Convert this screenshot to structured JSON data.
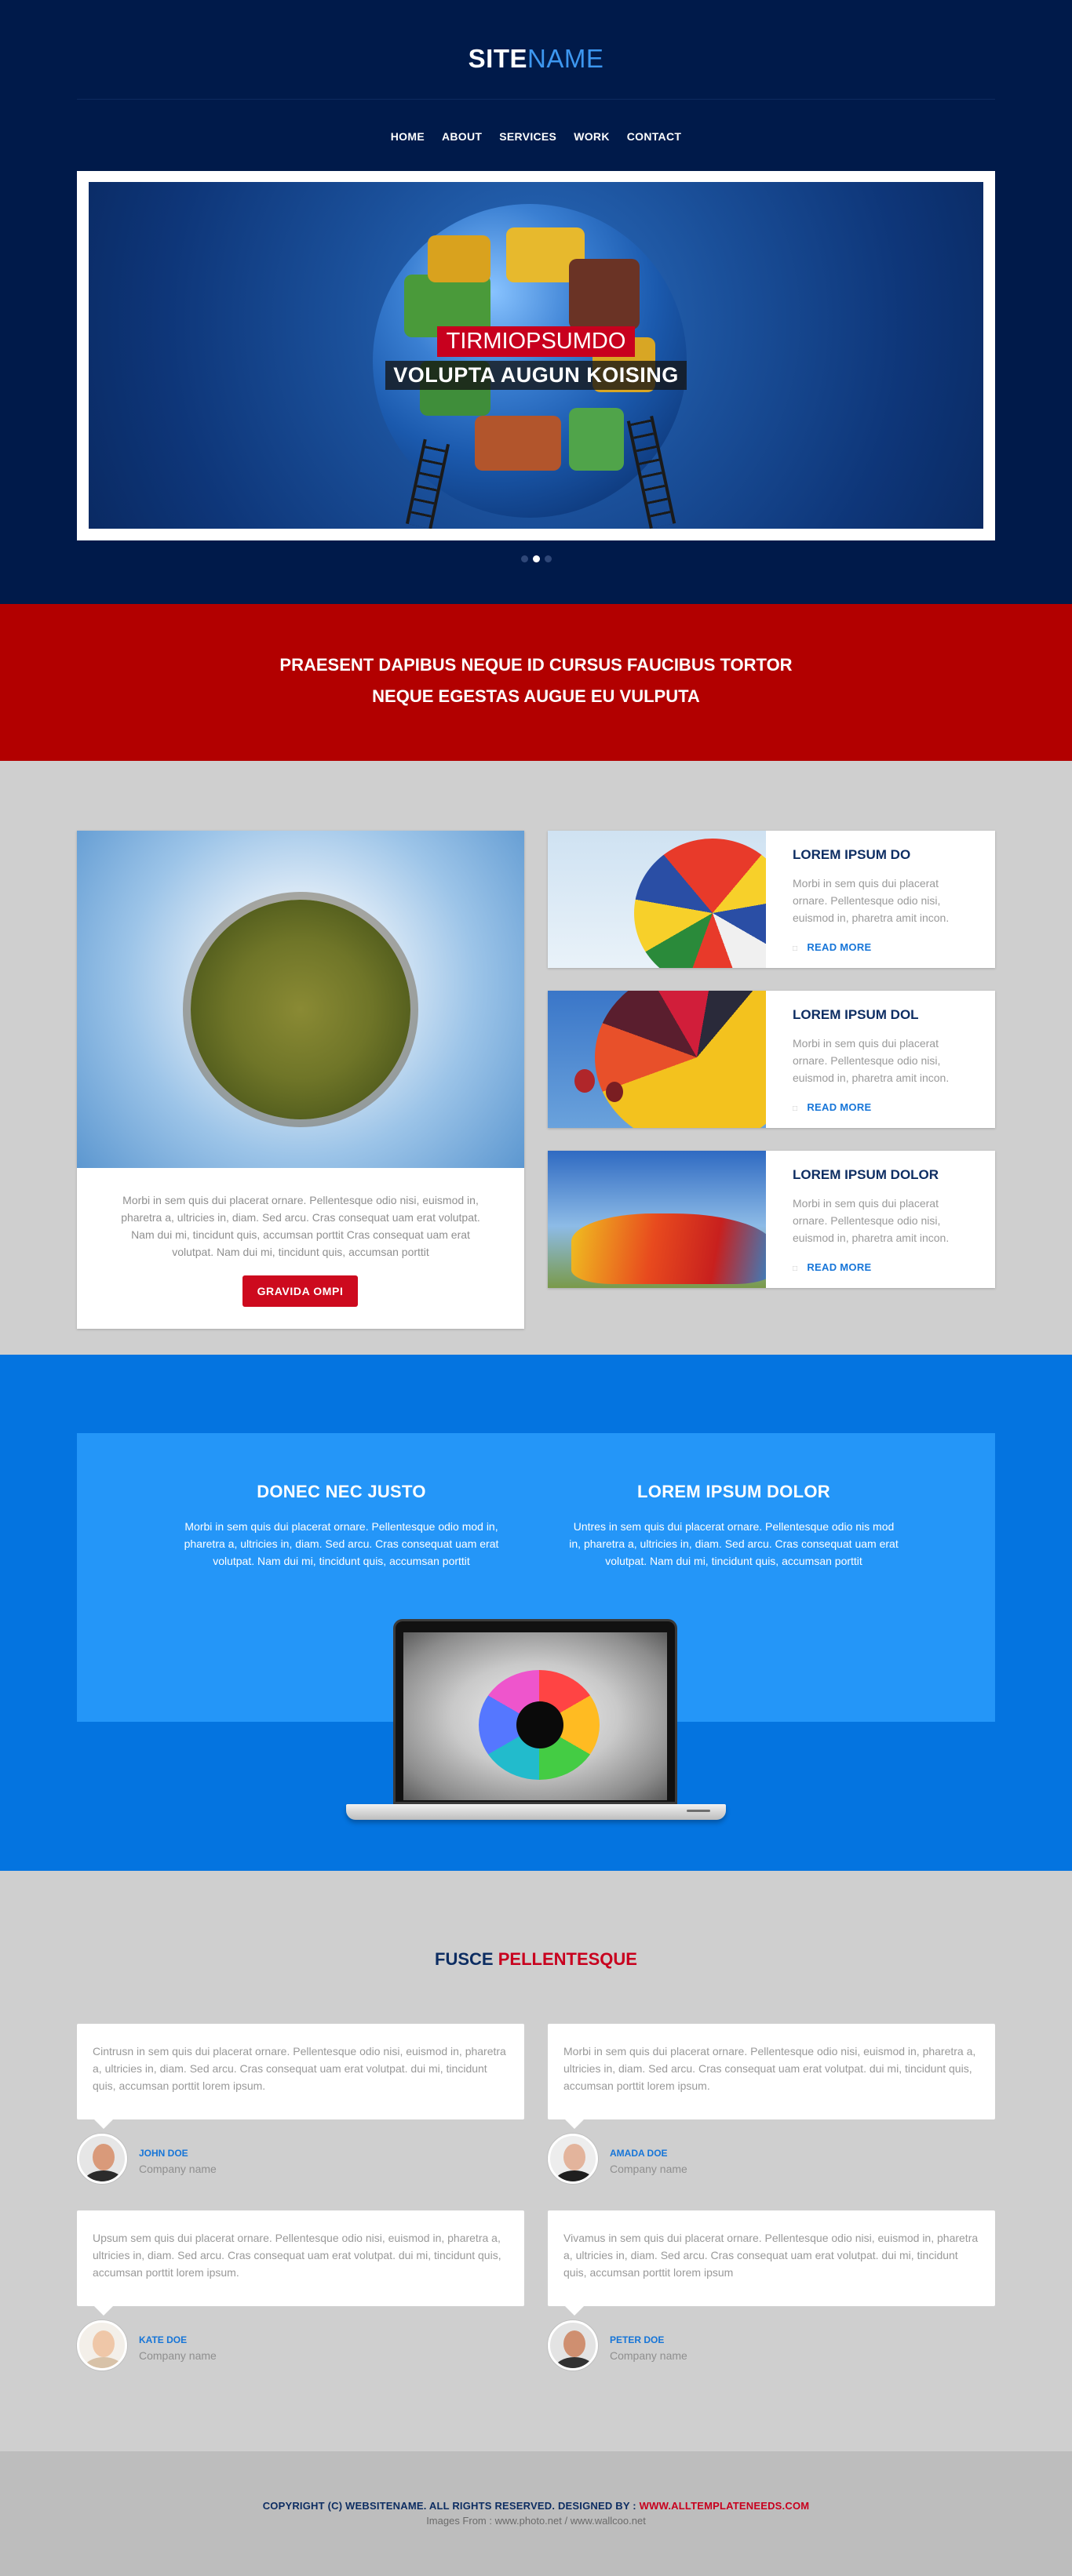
{
  "header": {
    "logo_part1": "SITE",
    "logo_part2": "NAME",
    "nav": [
      "HOME",
      "ABOUT",
      "SERVICES",
      "WORK",
      "CONTACT"
    ]
  },
  "slider": {
    "caption_title": "TIRMIOPSUMDO",
    "caption_subtitle": "VOLUPTA AUGUN KOISING",
    "dots_total": 3,
    "active_dot": 2
  },
  "banner": {
    "line1": "PRAESENT DAPIBUS NEQUE ID CURSUS FAUCIBUS TORTOR",
    "line2": "NEQUE EGESTAS AUGUE EU VULPUTA"
  },
  "features": {
    "main_text": "Morbi in sem quis dui placerat ornare. Pellentesque odio nisi, euismod in, pharetra a, ultricies in, diam. Sed arcu. Cras consequat uam erat volutpat. Nam dui mi, tincidunt quis, accumsan porttit Cras consequat uam erat volutpat. Nam dui mi, tincidunt quis, accumsan porttit",
    "main_button": "GRAVIDA OMPI",
    "cards": [
      {
        "title": "LOREM IPSUM DO",
        "text": "Morbi in sem quis dui placerat ornare. Pellentesque odio nisi, euismod in, pharetra amit incon.",
        "more": "READ MORE"
      },
      {
        "title": "LOREM IPSUM DOL",
        "text": "Morbi in sem quis dui placerat ornare. Pellentesque odio nisi, euismod in, pharetra amit incon.",
        "more": "READ MORE"
      },
      {
        "title": "LOREM IPSUM DOLOR",
        "text": "Morbi in sem quis dui placerat ornare. Pellentesque odio nisi, euismod in, pharetra amit incon.",
        "more": "READ MORE"
      }
    ]
  },
  "blue": {
    "col1_title": "DONEC NEC JUSTO",
    "col1_text": "Morbi in sem quis dui placerat ornare. Pellentesque odio mod in, pharetra a, ultricies in, diam. Sed arcu. Cras consequat uam erat volutpat. Nam dui mi, tincidunt quis, accumsan porttit",
    "col2_title": "LOREM IPSUM DOLOR",
    "col2_text": "Untres in sem quis dui placerat ornare. Pellentesque odio nis mod in, pharetra a, ultricies in, diam. Sed arcu. Cras consequat uam erat volutpat. Nam dui mi, tincidunt quis, accumsan porttit"
  },
  "testimonials": {
    "title_part1": "FUSCE",
    "title_part2": "PELLENTESQUE",
    "items": [
      {
        "quote": "Cintrusn in sem quis dui placerat ornare. Pellentesque odio nisi, euismod in, pharetra a, ultricies in, diam. Sed arcu. Cras consequat uam erat volutpat. dui mi, tincidunt quis, accumsan porttit lorem ipsum.",
        "name": "JOHN DOE",
        "company": "Company name"
      },
      {
        "quote": "Morbi in sem quis dui placerat ornare. Pellentesque odio nisi, euismod in, pharetra a, ultricies in, diam. Sed arcu. Cras consequat uam erat volutpat. dui mi, tincidunt quis, accumsan porttit lorem ipsum.",
        "name": "AMADA DOE",
        "company": "Company name"
      },
      {
        "quote": "Upsum sem quis dui placerat ornare. Pellentesque odio nisi, euismod in, pharetra a, ultricies in, diam. Sed arcu. Cras consequat uam erat volutpat. dui mi, tincidunt quis, accumsan porttit lorem ipsum.",
        "name": "KATE DOE",
        "company": "Company name"
      },
      {
        "quote": "Vivamus in sem quis dui placerat ornare. Pellentesque odio nisi, euismod in, pharetra a, ultricies in, diam. Sed arcu. Cras consequat uam erat volutpat. dui mi, tincidunt quis, accumsan porttit lorem ipsum",
        "name": "PETER DOE",
        "company": "Company name"
      }
    ]
  },
  "footer": {
    "copyright": "COPYRIGHT (C) WEBSITENAME. ALL RIGHTS RESERVED. DESIGNED BY :",
    "designer": "WWW.ALLTEMPLATENEEDS.COM",
    "images_credit": "Images From : www.photo.net / www.wallcoo.net"
  },
  "colors": {
    "navy": "#001a4a",
    "red": "#b20000",
    "blue": "#0474e0",
    "light_blue": "#2496f8",
    "accent_red": "#c8001e"
  }
}
